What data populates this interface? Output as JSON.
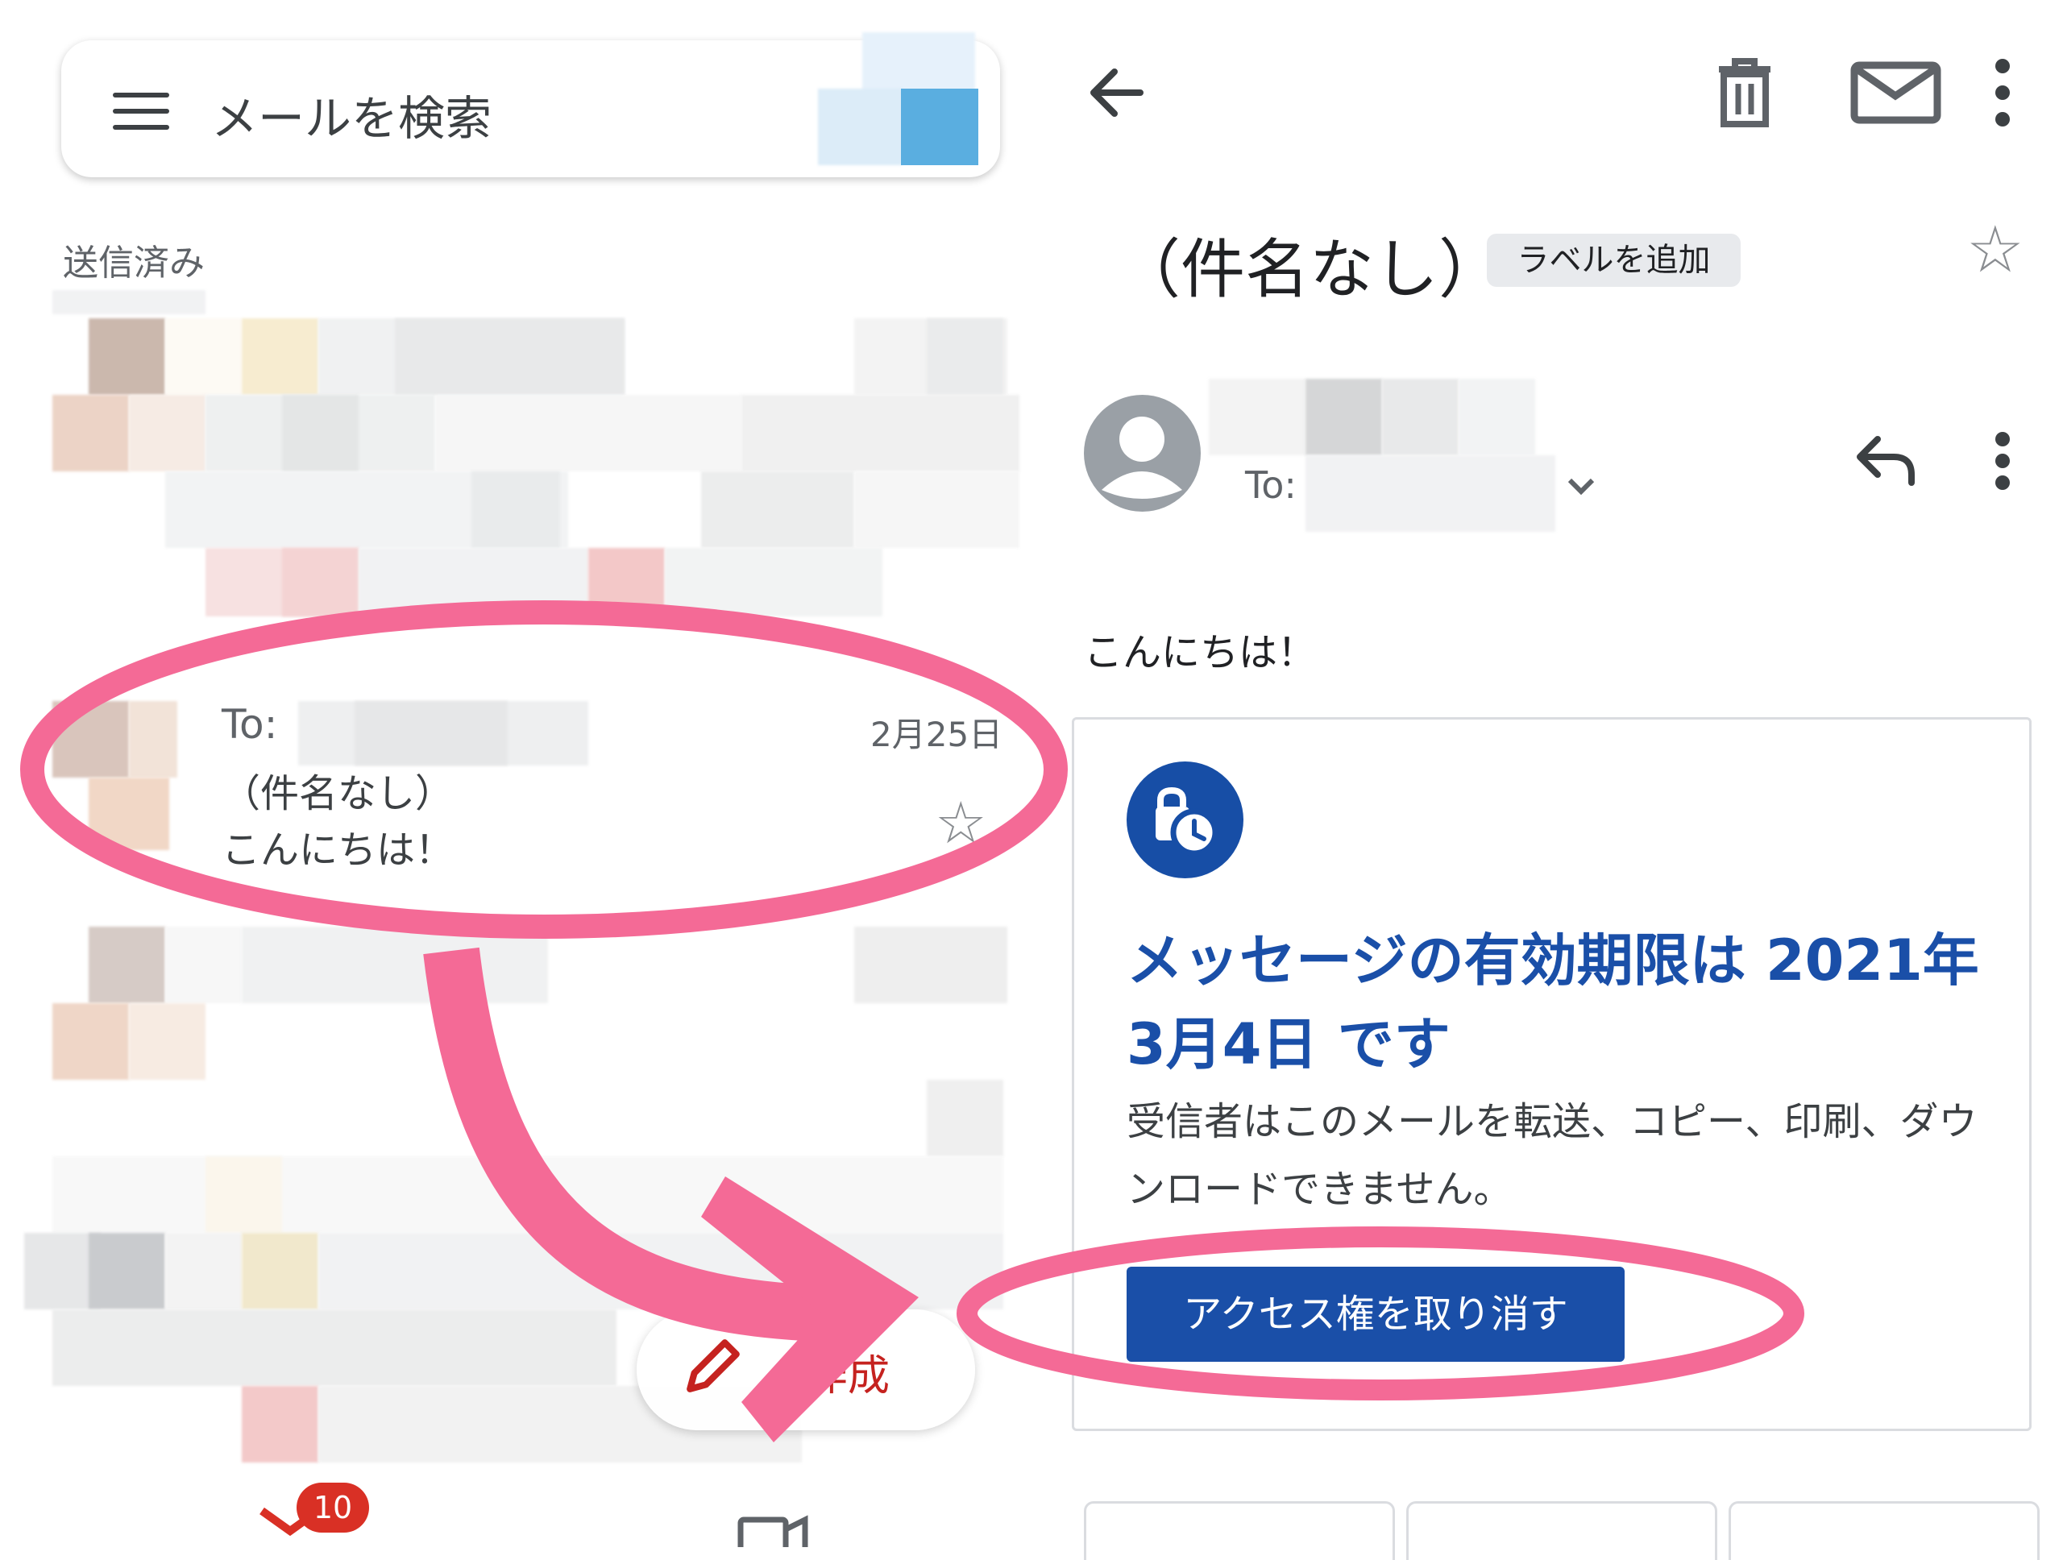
{
  "left_panel": {
    "search_placeholder": "メールを検索",
    "folder_label": "送信済み",
    "selected_email": {
      "to_label": "To:",
      "date": "2月25日",
      "subject": "（件名なし）",
      "snippet": "こんにちは！"
    },
    "compose_label": "作成",
    "inbox_badge_count": "10"
  },
  "right_panel": {
    "subject": "（件名なし）",
    "add_label_button": "ラベルを追加",
    "to_label": "To:",
    "greeting": "こんにちは！",
    "confidential": {
      "heading": "メッセージの有効期限は 2021年 3月4日 です",
      "description": "受信者はこのメールを転送、コピー、印刷、ダウンロードできません。",
      "revoke_button": "アクセス権を取り消す"
    }
  },
  "colors": {
    "accent_blue": "#1a4fa8",
    "annotation_pink": "#f46a96",
    "badge_red": "#d93025",
    "compose_red": "#c5221f"
  },
  "icons": [
    "menu-icon",
    "back-arrow-icon",
    "trash-icon",
    "mail-icon",
    "more-vert-icon",
    "star-icon",
    "reply-icon",
    "chevron-down-icon",
    "pencil-icon",
    "clock-lock-icon",
    "avatar-icon"
  ]
}
